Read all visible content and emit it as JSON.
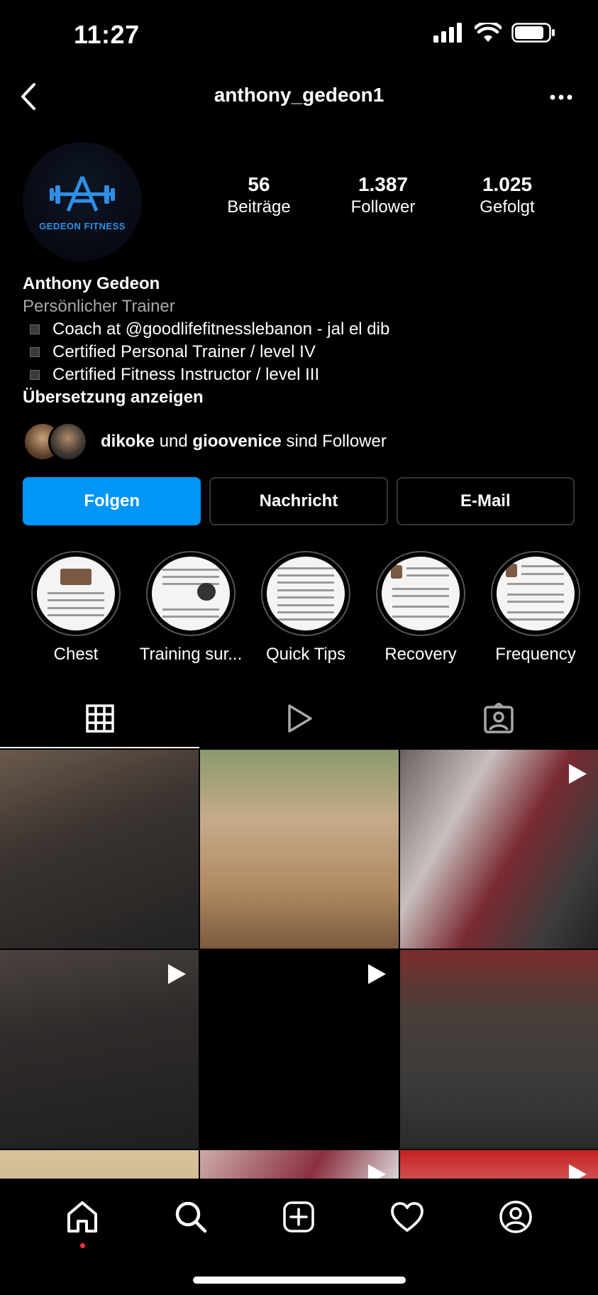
{
  "status_bar": {
    "time": "11:27"
  },
  "header": {
    "username": "anthony_gedeon1"
  },
  "profile": {
    "avatar_brand": "GEDEON FITNESS",
    "stats": [
      {
        "value": "56",
        "label": "Beiträge"
      },
      {
        "value": "1.387",
        "label": "Follower"
      },
      {
        "value": "1.025",
        "label": "Gefolgt"
      }
    ],
    "name": "Anthony Gedeon",
    "category": "Persönlicher Trainer",
    "bio_lines": [
      "Coach at @goodlifefitnesslebanon - jal el dib",
      "Certified Personal Trainer / level IV",
      "Certified Fitness Instructor / level III"
    ],
    "translate_label": "Übersetzung anzeigen",
    "followed_by": {
      "user1": "dikoke",
      "connector": "und",
      "user2": "gioovenice",
      "suffix": "sind Follower"
    }
  },
  "actions": {
    "follow": "Folgen",
    "message": "Nachricht",
    "email": "E-Mail"
  },
  "highlights": [
    {
      "label": "Chest"
    },
    {
      "label": "Training sur..."
    },
    {
      "label": "Quick Tips"
    },
    {
      "label": "Recovery"
    },
    {
      "label": "Frequency"
    }
  ],
  "tabs": [
    {
      "icon": "grid-icon",
      "active": true
    },
    {
      "icon": "reels-icon",
      "active": false
    },
    {
      "icon": "tagged-icon",
      "active": false
    }
  ],
  "grid_posts": [
    {
      "type": "photo"
    },
    {
      "type": "photo"
    },
    {
      "type": "video"
    },
    {
      "type": "video"
    },
    {
      "type": "video"
    },
    {
      "type": "photo"
    },
    {
      "type": "photo"
    },
    {
      "type": "video"
    },
    {
      "type": "video"
    }
  ],
  "bottom_nav": [
    "home-icon",
    "search-icon",
    "create-icon",
    "activity-icon",
    "profile-icon"
  ],
  "colors": {
    "primary": "#0095f6",
    "background": "#000000",
    "secondary_text": "#a8a8a8",
    "notification_dot": "#ff3040"
  }
}
